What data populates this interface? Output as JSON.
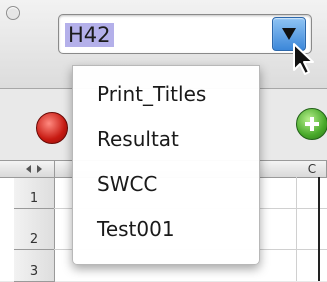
{
  "name_box": {
    "value": "H42"
  },
  "named_ranges_menu": {
    "items": [
      {
        "label": "Print_Titles"
      },
      {
        "label": "Resultat"
      },
      {
        "label": "SWCC"
      },
      {
        "label": "Test001"
      }
    ]
  },
  "sheet": {
    "column_headers": [
      "C"
    ],
    "row_headers": [
      "1",
      "2",
      "3"
    ]
  },
  "icons": {
    "dropdown": "chevron-down-icon",
    "cursor": "mouse-pointer-icon",
    "close": "close-workbook-icon",
    "add": "add-sheet-icon",
    "select_all": "select-all-corner-icon"
  },
  "colors": {
    "selection_highlight": "#b4b0ea",
    "dropdown_button": "#3c87d9",
    "close_orb": "#c71a12",
    "add_orb": "#48a92a"
  }
}
